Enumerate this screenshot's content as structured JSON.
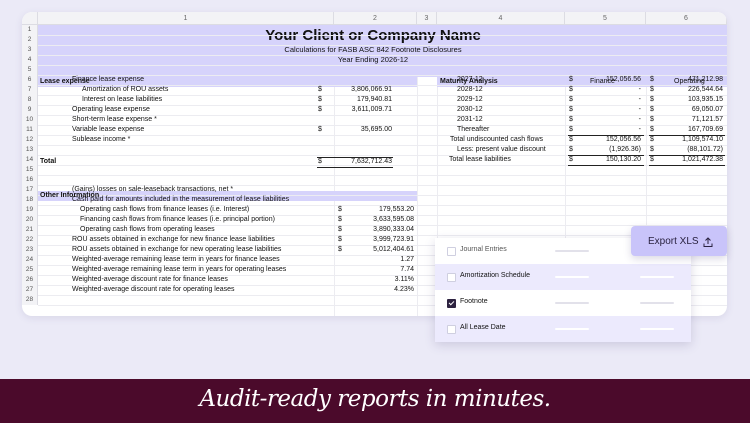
{
  "columns": [
    "1",
    "2",
    "3",
    "4",
    "5",
    "6"
  ],
  "rows": [
    "1",
    "2",
    "3",
    "4",
    "5",
    "6",
    "7",
    "8",
    "9",
    "10",
    "11",
    "12",
    "13",
    "14",
    "15",
    "16",
    "17",
    "18",
    "19",
    "20",
    "21",
    "22",
    "23",
    "24",
    "25",
    "26",
    "27",
    "28"
  ],
  "header": {
    "title": "Your Client or Company Name",
    "subtitle": "Calculations for FASB ASC 842 Footnote Disclosures",
    "period": "Year Ending 2026-12"
  },
  "lease_expense": {
    "heading": "Lease expense",
    "lines": [
      {
        "label": "Finance lease expense",
        "cur": "",
        "value": ""
      },
      {
        "label": "Amortization of ROU assets",
        "cur": "$",
        "value": "3,806,066.91"
      },
      {
        "label": "Interest on lease liabilities",
        "cur": "$",
        "value": "179,940.81"
      },
      {
        "label": "Operating lease expense",
        "cur": "$",
        "value": "3,611,009.71"
      },
      {
        "label": "Short-term lease expense *",
        "cur": "",
        "value": ""
      },
      {
        "label": "Variable lease expense",
        "cur": "$",
        "value": "35,695.00"
      },
      {
        "label": "Sublease income *",
        "cur": "",
        "value": ""
      }
    ],
    "total_label": "Total",
    "total_cur": "$",
    "total_value": "7,632,712.43"
  },
  "maturity": {
    "heading": "Maturity Analysis",
    "finance_header": "Finance",
    "operating_header": "Operating",
    "rows": [
      {
        "label": "2027-12",
        "fin": "152,056.56",
        "op": "471,212.98"
      },
      {
        "label": "2028-12",
        "fin": "-",
        "op": "226,544.64"
      },
      {
        "label": "2029-12",
        "fin": "-",
        "op": "103,935.15"
      },
      {
        "label": "2030-12",
        "fin": "-",
        "op": "69,050.07"
      },
      {
        "label": "2031-12",
        "fin": "-",
        "op": "71,121.57"
      },
      {
        "label": "Thereafter",
        "fin": "-",
        "op": "167,709.69"
      },
      {
        "label": "Total undiscounted cash flows",
        "fin": "152,056.56",
        "op": "1,109,574.10"
      },
      {
        "label": "Less: present value discount",
        "fin": "(1,926.36)",
        "op": "(88,101.72)"
      },
      {
        "label": "Total lease liabilities",
        "fin": "150,130.20",
        "op": "1,021,472.38"
      }
    ],
    "currency": "$"
  },
  "other_info": {
    "heading": "Other Information",
    "lines": [
      {
        "label": "(Gains) losses on sale-leaseback transactions, net *",
        "cur": "",
        "value": ""
      },
      {
        "label": "Cash paid for amounts included in the measurement of lease liabilities",
        "cur": "",
        "value": ""
      },
      {
        "label": "Operating cash flows from finance leases (i.e. Interest)",
        "cur": "$",
        "value": "179,553.20"
      },
      {
        "label": "Financing cash flows from finance leases (i.e. principal portion)",
        "cur": "$",
        "value": "3,633,595.08"
      },
      {
        "label": "Operating cash flows from operating leases",
        "cur": "$",
        "value": "3,890,333.04"
      },
      {
        "label": "ROU assets obtained in exchange for new finance lease liabilities",
        "cur": "$",
        "value": "3,999,723.91"
      },
      {
        "label": "ROU assets obtained in exchange for new operating  lease liabilities",
        "cur": "$",
        "value": "5,012,404.61"
      },
      {
        "label": "Weighted-average remaining lease term in years for finance leases",
        "cur": "",
        "value": "1.27"
      },
      {
        "label": "Weighted-average remaining lease term in years for operating leases",
        "cur": "",
        "value": "7.74"
      },
      {
        "label": "Weighted-average discount rate for finance leases",
        "cur": "",
        "value": "3.11%"
      },
      {
        "label": "Weighted-average discount rate for operating leases",
        "cur": "",
        "value": "4.23%"
      }
    ]
  },
  "report_options": [
    {
      "label": "Journal Entries",
      "checked": false
    },
    {
      "label": "Amortization Schedule",
      "checked": false
    },
    {
      "label": "Footnote",
      "checked": true
    },
    {
      "label": "All Lease Date",
      "checked": false
    }
  ],
  "export_button": {
    "label": "Export XLS",
    "icon": "upload-icon"
  },
  "tagline": "Audit-ready reports in minutes.",
  "colors": {
    "accent": "#d6d3fb",
    "banner": "#4b0a2b",
    "background": "#ebeaf7",
    "export_button": "#c9c4fa"
  }
}
